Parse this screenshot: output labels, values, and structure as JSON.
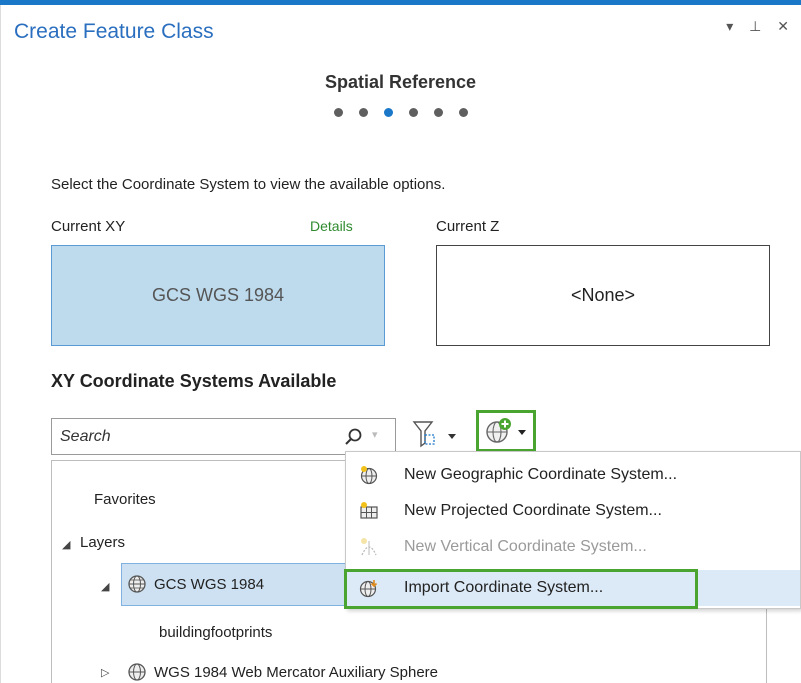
{
  "pane": {
    "title": "Create Feature Class",
    "controls": "▾ ⊥ ✕"
  },
  "wizard": {
    "step_title": "Spatial Reference",
    "step_count": 6,
    "active_step": 3
  },
  "instructions": "Select the Coordinate System to view the available options.",
  "current_xy": {
    "label": "Current XY",
    "details_link": "Details",
    "value": "GCS WGS 1984"
  },
  "current_z": {
    "label": "Current Z",
    "value": "<None>"
  },
  "section_title": "XY Coordinate Systems Available",
  "search": {
    "placeholder": "Search"
  },
  "tree": {
    "favorites": "Favorites",
    "layers": "Layers",
    "selected_node": "GCS WGS 1984",
    "child_layer": "buildingfootprints",
    "next_node": "WGS 1984 Web Mercator Auxiliary Sphere"
  },
  "menu": {
    "items": [
      {
        "label": "New Geographic Coordinate System...",
        "icon": "new-geographic-icon",
        "enabled": true
      },
      {
        "label": "New Projected Coordinate System...",
        "icon": "new-projected-icon",
        "enabled": true
      },
      {
        "label": "New Vertical Coordinate System...",
        "icon": "new-vertical-icon",
        "enabled": false
      },
      {
        "label": "Import Coordinate System...",
        "icon": "import-globe-icon",
        "enabled": true
      }
    ]
  },
  "colors": {
    "accent": "#1b78c9",
    "highlight_green": "#4aa530",
    "selected_fill": "#bedbee",
    "details_green": "#2f8a2f"
  }
}
